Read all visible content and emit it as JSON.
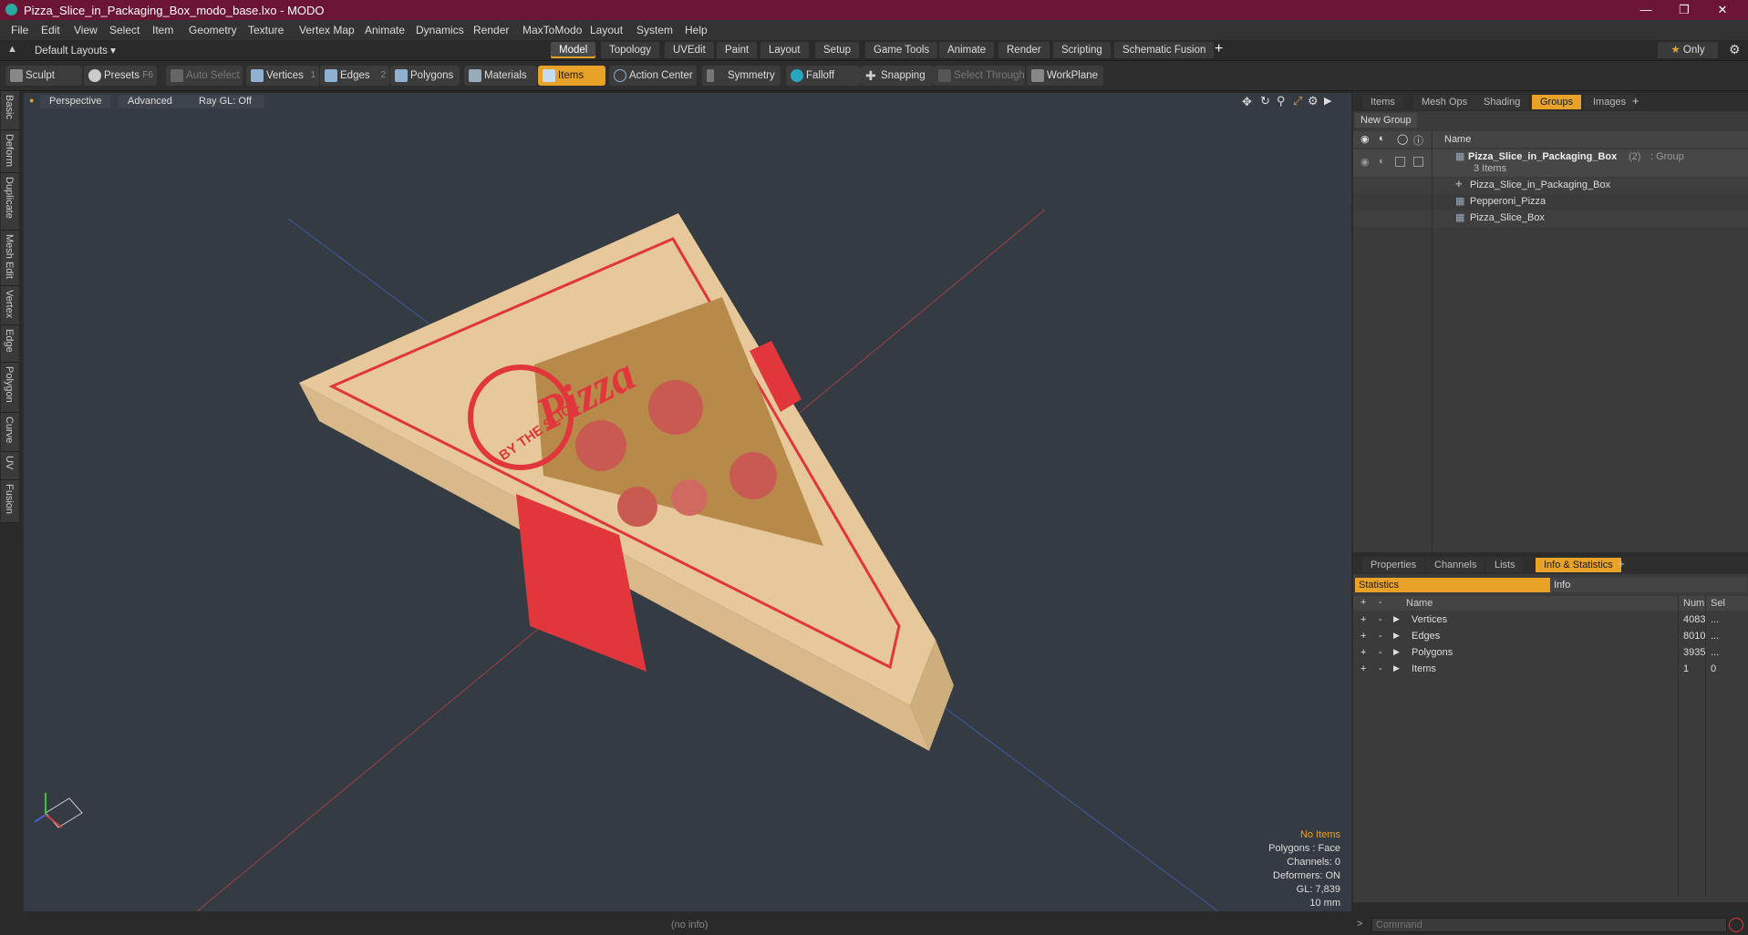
{
  "window": {
    "title": "Pizza_Slice_in_Packaging_Box_modo_base.lxo - MODO"
  },
  "menu": [
    "File",
    "Edit",
    "View",
    "Select",
    "Item",
    "Geometry",
    "Texture",
    "Vertex Map",
    "Animate",
    "Dynamics",
    "Render",
    "MaxToModo",
    "Layout",
    "System",
    "Help"
  ],
  "layouts": {
    "current": "Default Layouts",
    "tabs": [
      "Model",
      "Topology",
      "UVEdit",
      "Paint",
      "Layout",
      "Setup",
      "Game Tools",
      "Animate",
      "Render",
      "Scripting",
      "Schematic Fusion"
    ],
    "active": "Model",
    "only_label": "Only"
  },
  "toolbar": {
    "sculpt": "Sculpt",
    "presets": "Presets",
    "presets_key": "F6",
    "auto_select": "Auto Select",
    "vertices": "Vertices",
    "vertices_key": "1",
    "edges": "Edges",
    "edges_key": "2",
    "polygons": "Polygons",
    "materials": "Materials",
    "items": "Items",
    "action_center": "Action Center",
    "symmetry": "Symmetry",
    "falloff": "Falloff",
    "snapping": "Snapping",
    "select_through": "Select Through",
    "workplane": "WorkPlane"
  },
  "left_tabs": [
    "Basic",
    "Deform",
    "Duplicate",
    "Mesh Edit",
    "Vertex",
    "Edge",
    "Polygon",
    "Curve",
    "UV",
    "Fusion"
  ],
  "viewport": {
    "view": "Perspective",
    "shading": "Advanced",
    "raygl": "Ray GL: Off",
    "box_brand": "Pizza",
    "box_tagline": "BY THE SLICE",
    "hud": {
      "items": "No Items",
      "polygons": "Polygons : Face",
      "channels": "Channels: 0",
      "deformers": "Deformers: ON",
      "gl": "GL: 7,839",
      "scale": "10 mm"
    },
    "status": "(no info)"
  },
  "items_panel": {
    "tabs": [
      "Items",
      "Mesh Ops",
      "Shading",
      "Groups",
      "Images"
    ],
    "active": "Groups",
    "new_group": "New Group",
    "col_name": "Name",
    "group": {
      "name": "Pizza_Slice_in_Packaging_Box",
      "count": "(2)",
      "type": ": Group",
      "sub": "3 Items"
    },
    "children": [
      "Pizza_Slice_in_Packaging_Box",
      "Pepperoni_Pizza",
      "Pizza_Slice_Box"
    ]
  },
  "stats_panel": {
    "tabs": [
      "Properties",
      "Channels",
      "Lists",
      "Info & Statistics"
    ],
    "active": "Info & Statistics",
    "sub_tabs": [
      "Statistics",
      "Info"
    ],
    "cols": {
      "name": "Name",
      "num": "Num",
      "sel": "Sel"
    },
    "rows": [
      {
        "name": "Vertices",
        "num": "4083",
        "sel": "..."
      },
      {
        "name": "Edges",
        "num": "8010",
        "sel": "..."
      },
      {
        "name": "Polygons",
        "num": "3935",
        "sel": "..."
      },
      {
        "name": "Items",
        "num": "1",
        "sel": "0"
      }
    ]
  },
  "command": {
    "placeholder": "Command"
  },
  "colors": {
    "accent": "#e8a228",
    "titlebar": "#6b1434",
    "box_red": "#e0363c",
    "cardboard": "#e6c89a"
  }
}
